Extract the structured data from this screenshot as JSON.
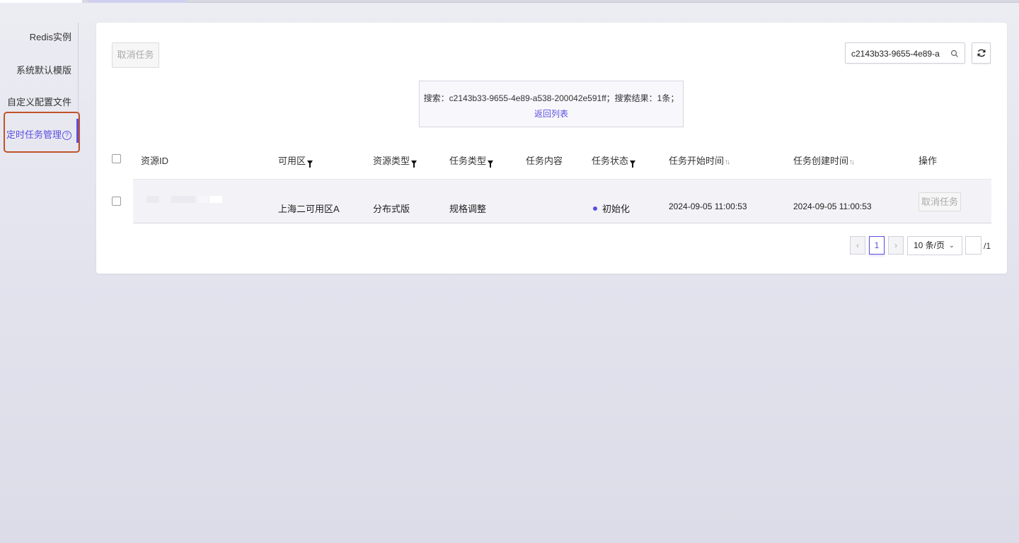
{
  "sidebar": {
    "items": [
      {
        "label": "Redis实例"
      },
      {
        "label": "系统默认模版"
      },
      {
        "label": "自定义配置文件"
      },
      {
        "label": "定时任务管理"
      }
    ]
  },
  "toolbar": {
    "cancel_task_label": "取消任务",
    "search_value": "c2143b33-9655-4e89-a"
  },
  "notice": {
    "text": "搜索：c2143b33-9655-4e89-a538-200042e591ff；搜索结果：1条；",
    "back_link": "返回列表"
  },
  "table": {
    "headers": {
      "resource_id": "资源ID",
      "zone": "可用区",
      "resource_type": "资源类型",
      "task_type": "任务类型",
      "task_content": "任务内容",
      "task_status": "任务状态",
      "start_time": "任务开始时间",
      "create_time": "任务创建时间",
      "action": "操作"
    },
    "rows": [
      {
        "zone": "上海二可用区A",
        "resource_type": "分布式版",
        "task_type": "规格调整",
        "task_content": "",
        "task_status": "初始化",
        "start_time": "2024-09-05 11:00:53",
        "create_time": "2024-09-05 11:00:53",
        "action": "取消任务"
      }
    ]
  },
  "pagination": {
    "prev": "‹",
    "current": "1",
    "next": "›",
    "page_size": "10 条/页",
    "total": "/1"
  },
  "colors": {
    "accent": "#5b4fe0",
    "highlight_border": "#c0532a"
  }
}
